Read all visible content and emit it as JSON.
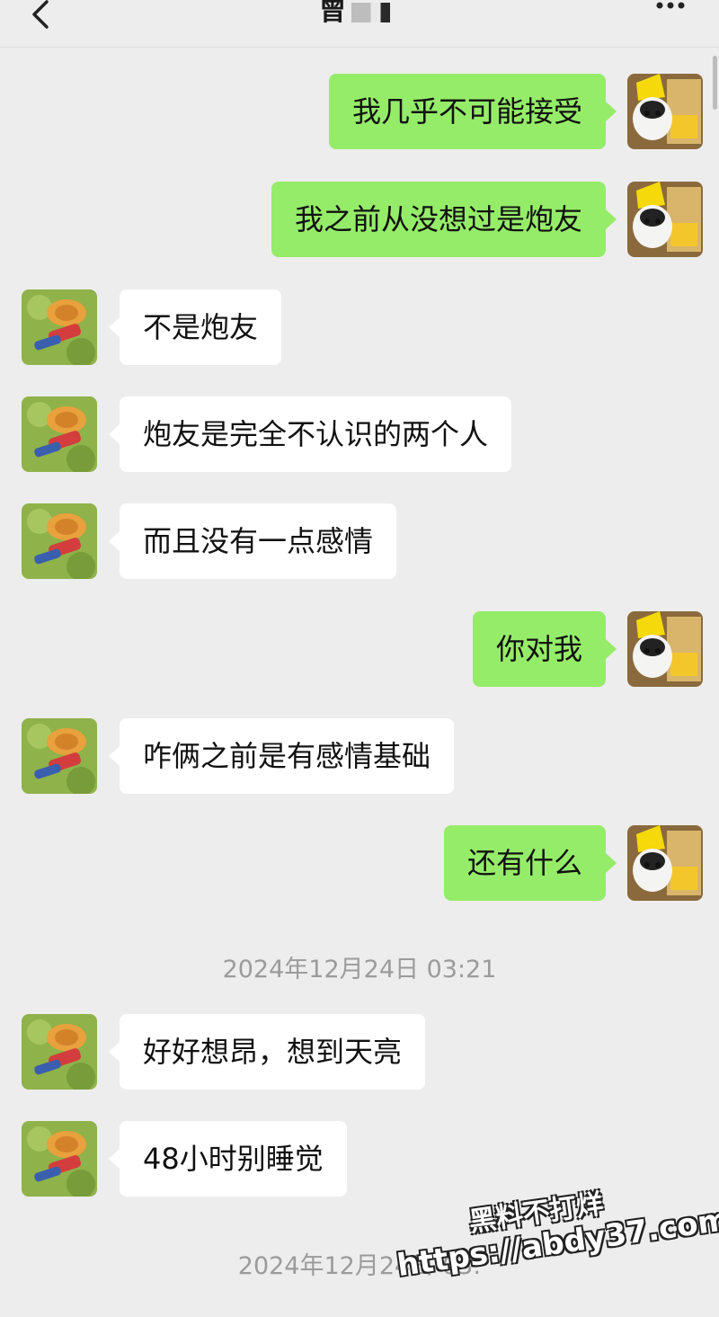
{
  "header": {
    "title": "曾",
    "back_icon": "chevron-left-icon",
    "more_icon": "more-horizontal-icon"
  },
  "avatars": {
    "self": "cat-in-banana-hat-avatar",
    "contact": "straw-hat-character-avatar"
  },
  "messages": [
    {
      "side": "right",
      "text": "我几乎不可能接受"
    },
    {
      "side": "right",
      "text": "我之前从没想过是炮友"
    },
    {
      "side": "left",
      "text": "不是炮友"
    },
    {
      "side": "left",
      "text": "炮友是完全不认识的两个人"
    },
    {
      "side": "left",
      "text": "而且没有一点感情"
    },
    {
      "side": "right",
      "text": "你对我"
    },
    {
      "side": "left",
      "text": "咋俩之前是有感情基础"
    },
    {
      "side": "right",
      "text": "还有什么"
    },
    {
      "side": "left",
      "text": "好好想昂，想到天亮"
    },
    {
      "side": "left",
      "text": "48小时别睡觉"
    }
  ],
  "timestamps": [
    "2024年12月24日 03:21",
    "2024年12月24日 03:"
  ],
  "watermark": {
    "line1": "黑料不打烊",
    "line2": "https://abdy37.com"
  },
  "colors": {
    "self_bubble": "#95ec69",
    "contact_bubble": "#ffffff",
    "background": "#ededed"
  }
}
